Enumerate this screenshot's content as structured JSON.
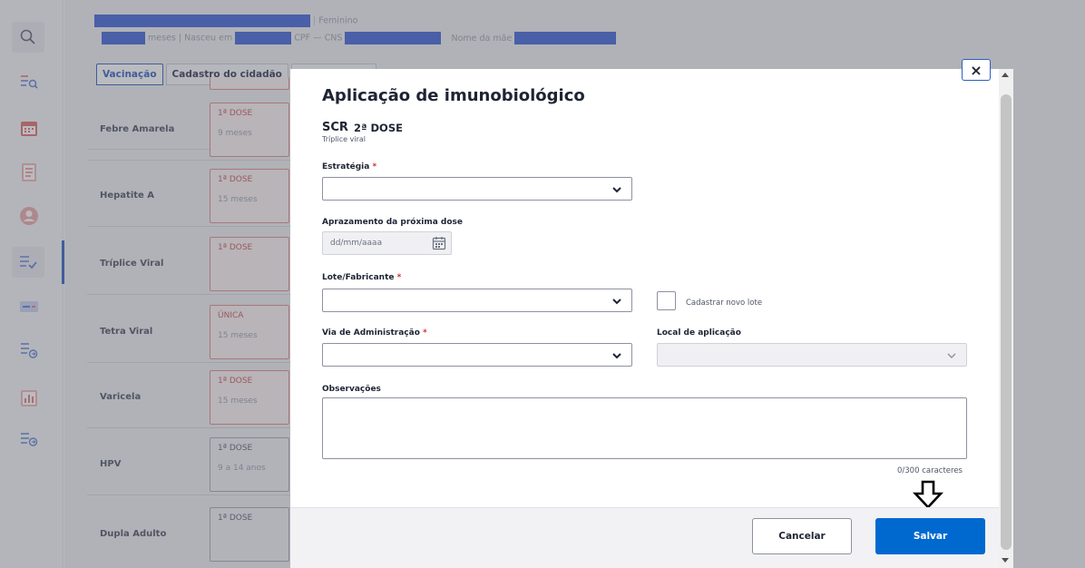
{
  "patient": {
    "sex": "Feminino",
    "age_suffix": "meses | Nasceu em",
    "cpf_label": "CPF —  CNS",
    "mother_label": "Nome da mãe"
  },
  "tabs": [
    {
      "label": "Vacinação",
      "active": true
    },
    {
      "label": "Cadastro do cidadão",
      "active": false
    },
    {
      "label": "",
      "active": false
    }
  ],
  "vaccines": [
    {
      "name": "Febre Amarela",
      "dose": "1ª DOSE",
      "age": "9 meses",
      "status": "pending"
    },
    {
      "name": "Hepatite A",
      "dose": "1ª DOSE",
      "age": "15 meses",
      "status": "pending"
    },
    {
      "name": "Tríplice Viral",
      "dose": "1ª DOSE",
      "age": "",
      "status": "pending"
    },
    {
      "name": "Tetra Viral",
      "dose": "ÚNICA",
      "age": "15 meses",
      "status": "pending"
    },
    {
      "name": "Varicela",
      "dose": "1ª DOSE",
      "age": "15 meses",
      "status": "pending"
    },
    {
      "name": "HPV",
      "dose": "1ª DOSE",
      "age": "9 a 14 anos",
      "status": "neutral"
    },
    {
      "name": "Dupla Adulto",
      "dose": "1ª DOSE",
      "age": "",
      "status": "neutral"
    }
  ],
  "modal": {
    "title": "Aplicação de imunobiológico",
    "close_label": "×",
    "vaccine_code": "SCR",
    "vaccine_dose": "2ª DOSE",
    "vaccine_name": "Tríplice viral",
    "fields": {
      "estrategia": {
        "label": "Estratégia",
        "required": "*",
        "value": ""
      },
      "aprazamento": {
        "label": "Aprazamento da próxima dose",
        "placeholder": "dd/mm/aaaa"
      },
      "lote": {
        "label": "Lote/Fabricante",
        "required": "*",
        "value": ""
      },
      "novo_lote": {
        "label": "Cadastrar novo lote",
        "checked": false
      },
      "via": {
        "label": "Via de Administração",
        "required": "*",
        "value": ""
      },
      "local": {
        "label": "Local de aplicação",
        "value": "",
        "disabled": true
      },
      "observacoes": {
        "label": "Observações",
        "value": "",
        "counter": "0/300 caracteres"
      }
    },
    "buttons": {
      "cancel": "Cancelar",
      "save": "Salvar"
    }
  },
  "colors": {
    "primary": "#0069d0",
    "accent": "#2f5cc2",
    "required": "#d22d2d",
    "pending_dose": "#c85656",
    "redaction": "#3d61d6"
  },
  "icons": [
    "search-icon",
    "compare-icon",
    "calendar-icon",
    "document-icon",
    "user-icon",
    "checklist-icon",
    "form-icon",
    "list-icon",
    "chart-icon",
    "list-alt-icon",
    "chevron-down-icon",
    "close-icon",
    "arrow-down-icon"
  ]
}
